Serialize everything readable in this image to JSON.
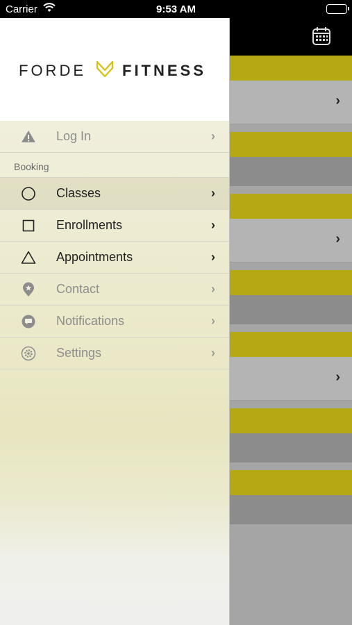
{
  "status_bar": {
    "carrier": "Carrier",
    "time": "9:53 AM"
  },
  "brand": {
    "name_left": "FORDE",
    "name_right": "FITNESS",
    "accent_color": "#d6c21a"
  },
  "menu": {
    "login": {
      "label": "Log In",
      "icon": "warning-icon"
    },
    "section_booking": "Booking",
    "classes": {
      "label": "Classes",
      "icon": "circle-icon"
    },
    "enrollments": {
      "label": "Enrollments",
      "icon": "square-icon"
    },
    "appointments": {
      "label": "Appointments",
      "icon": "triangle-icon"
    },
    "contact": {
      "label": "Contact",
      "icon": "location-pin-icon"
    },
    "notifications": {
      "label": "Notifications",
      "icon": "chat-bubble-icon"
    },
    "settings": {
      "label": "Settings",
      "icon": "gear-icon"
    }
  },
  "background": {
    "nav_icon": "calendar-icon",
    "band_yellow": "#b5a813",
    "band_light": "#b4b4b4",
    "band_dark": "#8c8c8c"
  }
}
